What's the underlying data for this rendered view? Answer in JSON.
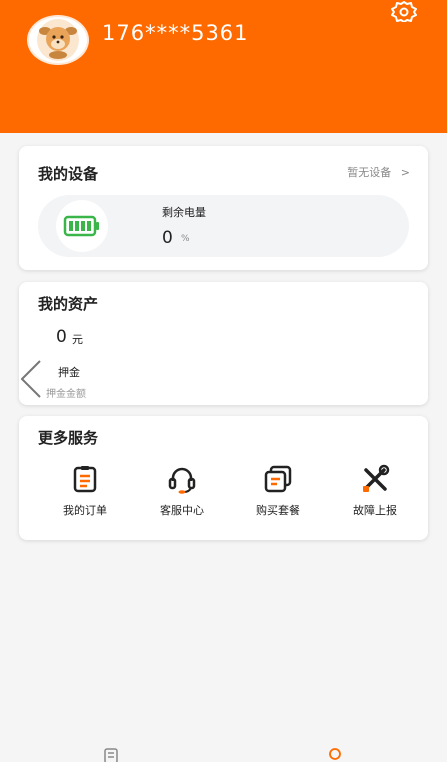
{
  "header": {
    "phone": "176****5361",
    "avatar_icon": "cartoon-deer-avatar",
    "settings_icon": "gear-icon",
    "background_color": "#ff6a00"
  },
  "device_card": {
    "title": "我的设备",
    "link_label": "暂无设备",
    "link_chevron": ">",
    "battery_icon": "battery-icon",
    "remaining_label": "剩余电量",
    "remaining_value": "0",
    "remaining_unit": "%"
  },
  "assets_card": {
    "title": "我的资产",
    "balance_value": "0",
    "balance_unit": "元",
    "deposit_label": "押金",
    "deposit_amount_label": "押金金额"
  },
  "services_card": {
    "title": "更多服务",
    "items": [
      {
        "label": "我的订单",
        "icon": "clipboard-icon"
      },
      {
        "label": "客服中心",
        "icon": "headset-icon"
      },
      {
        "label": "购买套餐",
        "icon": "package-icon"
      },
      {
        "label": "故障上报",
        "icon": "tools-icon"
      }
    ]
  },
  "tab_bar": {
    "icons": [
      "orders-tab-icon",
      "profile-tab-icon"
    ]
  },
  "colors": {
    "accent": "#ff6a00",
    "battery_green": "#39b54a"
  }
}
